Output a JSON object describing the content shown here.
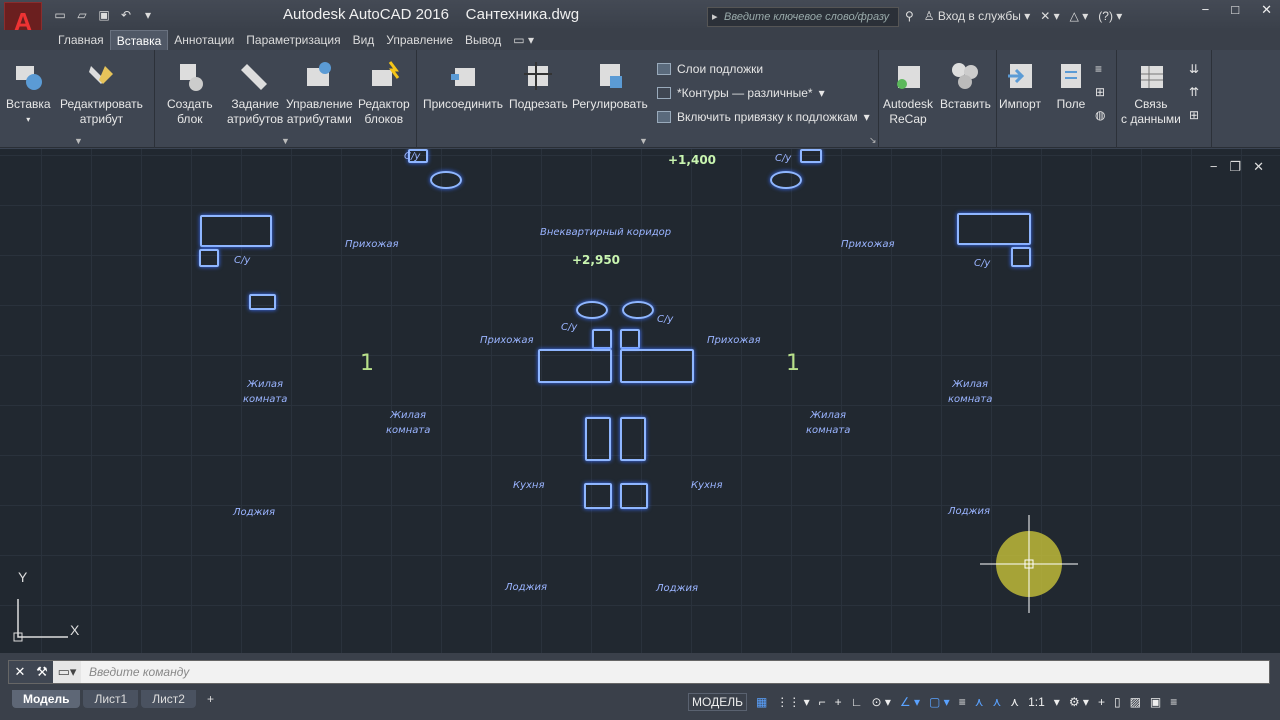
{
  "app": {
    "title": "Autodesk AutoCAD 2016",
    "file": "Сантехника.dwg",
    "logo": "A"
  },
  "search": {
    "placeholder": "Введите ключевое слово/фразу"
  },
  "account": {
    "signin": "Вход в службы",
    "help": "?"
  },
  "tabs": [
    {
      "label": "Главная"
    },
    {
      "label": "Вставка",
      "active": true
    },
    {
      "label": "Аннотации"
    },
    {
      "label": "Параметризация"
    },
    {
      "label": "Вид"
    },
    {
      "label": "Управление"
    },
    {
      "label": "Вывод"
    }
  ],
  "ribbon": {
    "insert": {
      "label": "Вставка"
    },
    "edit_attr": {
      "line1": "Редактировать",
      "line2": "атрибут"
    },
    "create_block": {
      "line1": "Создать",
      "line2": "блок"
    },
    "define_attr": {
      "line1": "Задание",
      "line2": "атрибутов"
    },
    "manage_attr": {
      "line1": "Управление",
      "line2": "атрибутами"
    },
    "block_editor": {
      "line1": "Редактор",
      "line2": "блоков"
    },
    "attach": {
      "label": "Присоединить"
    },
    "clip": {
      "label": "Подрезать"
    },
    "adjust": {
      "label": "Регулировать"
    },
    "underlay_layers": {
      "label": "Слои подложки"
    },
    "frames": {
      "label": "*Контуры — различные*"
    },
    "snap_underlay": {
      "label": "Включить привязку к подложкам"
    },
    "recap": {
      "line1": "Autodesk",
      "line2": "ReCap"
    },
    "paste": {
      "label": "Вставить"
    },
    "import": {
      "label": "Импорт"
    },
    "field": {
      "label": "Поле"
    },
    "data_link": {
      "line1": "Связь",
      "line2": "с данными"
    }
  },
  "drawing": {
    "labels": {
      "su": "С/у",
      "hall": "Прихожая",
      "corridor": "Внеквартирный коридор",
      "living_line1": "Жилая",
      "living_line2": "комната",
      "kitchen": "Кухня",
      "loggia": "Лоджия"
    },
    "elev1": "+1,400",
    "elev2": "+2,950",
    "apt_num": "1"
  },
  "ucs": {
    "x": "X",
    "y": "Y"
  },
  "command": {
    "placeholder": "Введите команду"
  },
  "layouts": [
    {
      "label": "Модель",
      "active": true
    },
    {
      "label": "Лист1"
    },
    {
      "label": "Лист2"
    }
  ],
  "status": {
    "model": "МОДЕЛЬ",
    "scale": "1:1"
  }
}
